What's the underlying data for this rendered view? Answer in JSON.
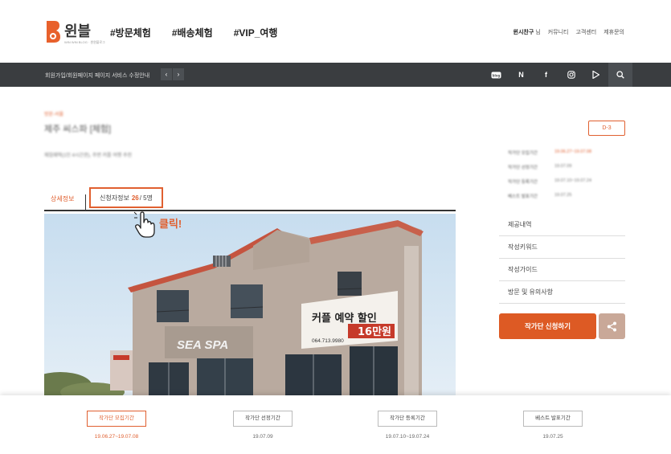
{
  "header": {
    "logo_text": "윈블",
    "logo_sub": "WIN WIN BLOG · 윈윈블로그",
    "nav": [
      "#방문체험",
      "#배송체험",
      "#VIP_여행"
    ],
    "user_name": "윈시찬구",
    "user_suffix": "님",
    "util": [
      "커뮤니티",
      "고객센터",
      "제휴문의"
    ]
  },
  "notice_bar": {
    "text": "회원가입/회원페이지 페이지 서비스 수정안내",
    "prev": "‹",
    "next": "›",
    "social_icons": [
      "blog-icon",
      "naver-icon",
      "facebook-icon",
      "instagram-icon",
      "play-icon",
      "search-icon"
    ],
    "social_labels": [
      "blog",
      "N",
      "f",
      "◎",
      "▶",
      "⌕"
    ]
  },
  "campaign": {
    "category": "방문-서울",
    "title": "제주 씨스파 [체험]",
    "description": "체험혜택(1인 4시간권), 주변 커플 여행 추천"
  },
  "tabs": {
    "detail": "상세정보",
    "applicants_label": "신청자정보",
    "applicants_count": "26",
    "applicants_total": "/ 5명"
  },
  "annotation": {
    "click_label": "클릭!"
  },
  "photo": {
    "banner_line1": "커플 예약 할인",
    "banner_line2": "16만원",
    "banner_phone": "064.713.9980",
    "sign_text": "SEA SPA"
  },
  "sidebar": {
    "d_badge": "D-3",
    "schedule": [
      {
        "label": "작가단 모집기간",
        "value": "19.06.27~19.07.08",
        "highlight": true
      },
      {
        "label": "작가단 선정기간",
        "value": "19.07.09",
        "highlight": false
      },
      {
        "label": "작가단 등록기간",
        "value": "19.07.10~19.07.24",
        "highlight": false
      },
      {
        "label": "베스트 발표기간",
        "value": "19.07.25",
        "highlight": false
      }
    ],
    "menu": [
      "제공내역",
      "작성키워드",
      "작성가이드",
      "방문 및 유의사항"
    ],
    "apply_button": "작가단 신청하기"
  },
  "timeline": [
    {
      "label": "작가단 모집기간",
      "date": "19.06.27~19.07.08",
      "active": true
    },
    {
      "label": "작가단 선정기간",
      "date": "19.07.09",
      "active": false
    },
    {
      "label": "작가단 등록기간",
      "date": "19.07.10~19.07.24",
      "active": false
    },
    {
      "label": "베스트 발표기간",
      "date": "19.07.25",
      "active": false
    }
  ],
  "colors": {
    "accent": "#e06030",
    "dark_bar": "#3a3d40",
    "apply_button": "#dd5a24"
  }
}
